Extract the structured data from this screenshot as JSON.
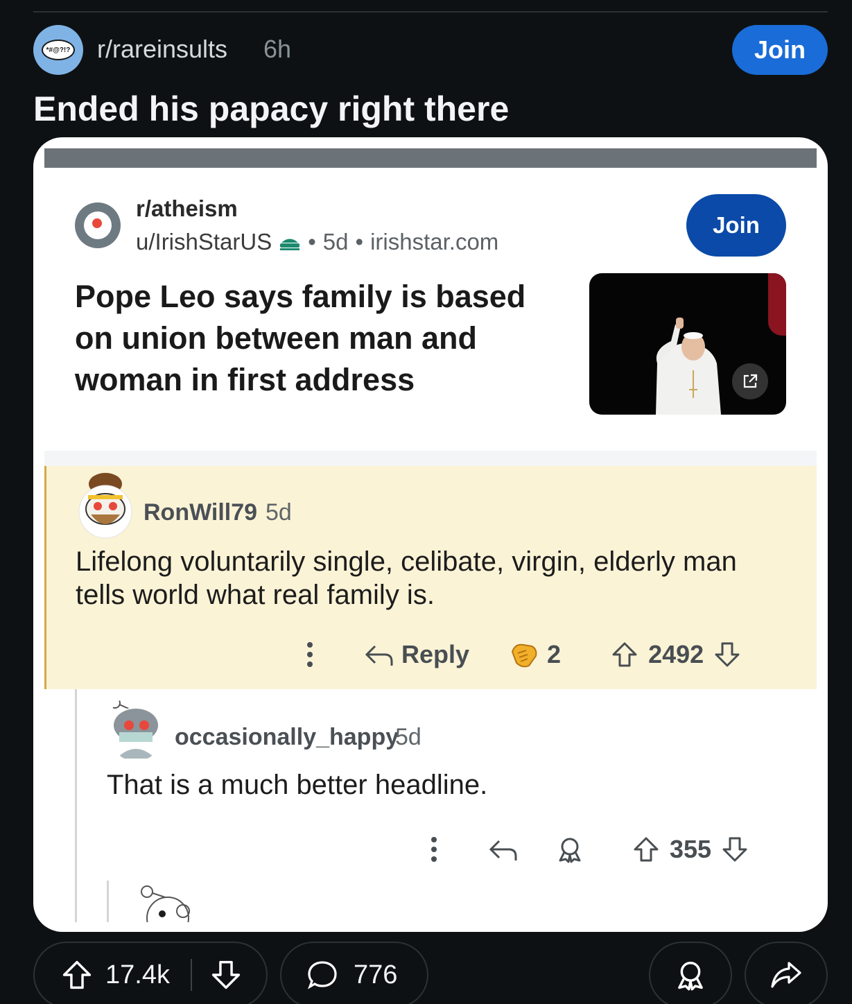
{
  "header": {
    "subreddit": "r/rareinsults",
    "time": "6h",
    "join_label": "Join",
    "avatar_text": "*#@?!?"
  },
  "post": {
    "title": "Ended his papacy right there"
  },
  "embedded": {
    "subreddit": "r/atheism",
    "user": "u/IrishStarUS",
    "dot": "•",
    "age": "5d",
    "domain": "irishstar.com",
    "join_label": "Join",
    "article_title": "Pope Leo says family is based on union between man and woman in first address"
  },
  "comments": [
    {
      "username": "RonWill79",
      "time": "5d",
      "body": "Lifelong voluntarily single, celibate, virgin, elderly man tells world what real family is.",
      "reply_label": "Reply",
      "awards": "2",
      "score": "2492"
    },
    {
      "username": "occasionally_happy",
      "time": "5d",
      "body": "That is a much better headline.",
      "score": "355"
    }
  ],
  "footer": {
    "upvotes": "17.4k",
    "comments": "776"
  },
  "colors": {
    "background": "#0e1113",
    "join_blue": "#1a6cd8",
    "embedded_join": "#0b4aa8",
    "highlight": "#fbf3d6"
  }
}
